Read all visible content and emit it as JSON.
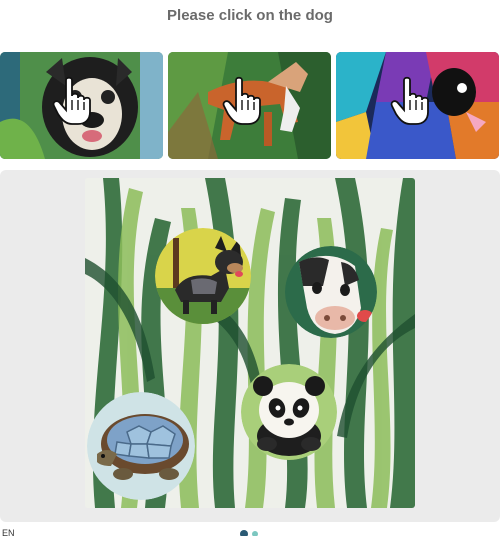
{
  "prompt": "Please click on the dog",
  "examples": [
    {
      "animal": "dog",
      "style": "watercolor portrait",
      "pointer": "hand-pointer-icon"
    },
    {
      "animal": "dog",
      "style": "watercolor running dog",
      "pointer": "hand-pointer-icon"
    },
    {
      "animal": "dog",
      "style": "colorful abstract dog",
      "pointer": "hand-pointer-icon"
    }
  ],
  "board": {
    "background": "watercolor leaves",
    "animals": [
      "dog",
      "cow",
      "panda",
      "turtle"
    ]
  },
  "footer": {
    "language": "EN"
  },
  "colors": {
    "prompt": "#6b6b6b",
    "board_bg": "#ebebeb",
    "leaf_dark": "#2f6b3a",
    "leaf_light": "#8cbd5a"
  }
}
